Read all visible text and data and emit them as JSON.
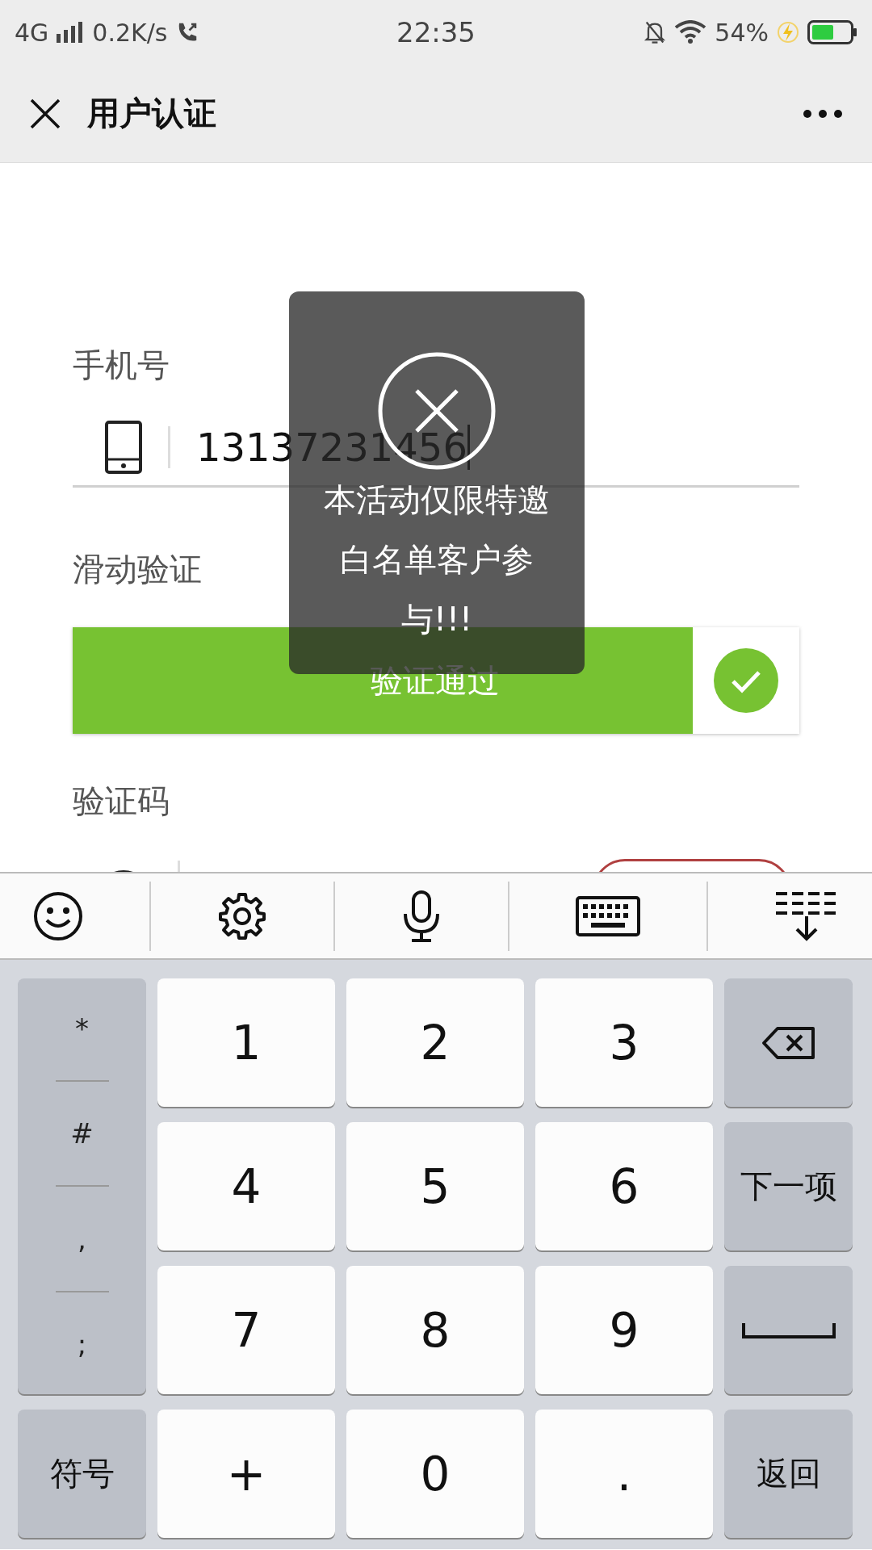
{
  "status_bar": {
    "network": "4G",
    "speed": "0.2K/s",
    "time": "22:35",
    "battery": "54%"
  },
  "header": {
    "title": "用户认证"
  },
  "form": {
    "phone": {
      "label": "手机号",
      "value": "13137231456"
    },
    "slider": {
      "label": "滑动验证",
      "text": "验证通过",
      "passed": true
    },
    "code": {
      "label": "验证码"
    }
  },
  "toast": {
    "message": "本活动仅限特邀白名单客户参与!!!"
  },
  "keyboard": {
    "side_keys": [
      "*",
      "#",
      ",",
      ";"
    ],
    "keys": [
      {
        "kind": "digit",
        "label": "1"
      },
      {
        "kind": "digit",
        "label": "2"
      },
      {
        "kind": "digit",
        "label": "3"
      },
      {
        "kind": "backspace"
      },
      {
        "kind": "digit",
        "label": "4"
      },
      {
        "kind": "digit",
        "label": "5"
      },
      {
        "kind": "digit",
        "label": "6"
      },
      {
        "kind": "function",
        "label": "下一项"
      },
      {
        "kind": "digit",
        "label": "7"
      },
      {
        "kind": "digit",
        "label": "8"
      },
      {
        "kind": "digit",
        "label": "9"
      },
      {
        "kind": "space"
      },
      {
        "kind": "function",
        "label": "符号"
      },
      {
        "kind": "digit",
        "label": "+"
      },
      {
        "kind": "digit",
        "label": "0"
      },
      {
        "kind": "digit",
        "label": "."
      },
      {
        "kind": "function",
        "label": "返回"
      }
    ]
  }
}
